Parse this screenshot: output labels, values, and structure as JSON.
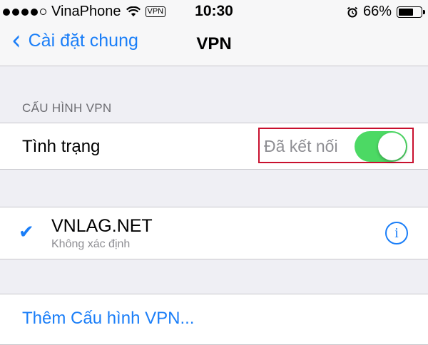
{
  "status_bar": {
    "carrier": "VinaPhone",
    "vpn_badge": "VPN",
    "time": "10:30",
    "battery_text": "66%",
    "battery_level": 0.66,
    "signal_bars": 4,
    "icons": [
      "wifi-icon",
      "alarm-icon",
      "battery-icon"
    ]
  },
  "nav": {
    "back_label": "Cài đặt chung",
    "title": "VPN"
  },
  "section": {
    "header": "CẤU HÌNH VPN"
  },
  "status_row": {
    "label": "Tình trạng",
    "value": "Đã kết nối",
    "toggle_on": true
  },
  "vpn_config": {
    "name": "VNLAG.NET",
    "subtitle": "Không xác định",
    "selected": true
  },
  "add_config": {
    "label": "Thêm Cấu hình VPN..."
  },
  "colors": {
    "accent": "#1a7ef8",
    "toggle_on": "#4cd964",
    "highlight_box": "#c8102e",
    "background": "#efeff4"
  }
}
